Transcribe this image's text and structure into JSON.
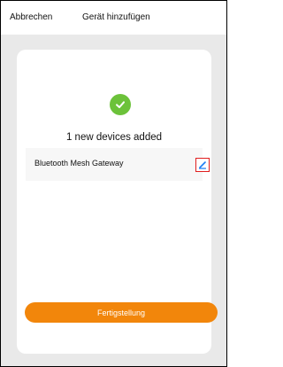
{
  "header": {
    "cancel_label": "Abbrechen",
    "title": "Gerät hinzufügen"
  },
  "result": {
    "message": "1 new devices added",
    "icon": "check-circle-icon"
  },
  "devices": [
    {
      "name": "Bluetooth Mesh Gateway",
      "edit_icon": "pencil-icon"
    }
  ],
  "footer": {
    "finish_label": "Fertigstellung"
  },
  "colors": {
    "accent_orange": "#f2860b",
    "success_green": "#6cc23a",
    "edit_blue": "#1b7df5",
    "highlight_red": "#e01f1f"
  }
}
